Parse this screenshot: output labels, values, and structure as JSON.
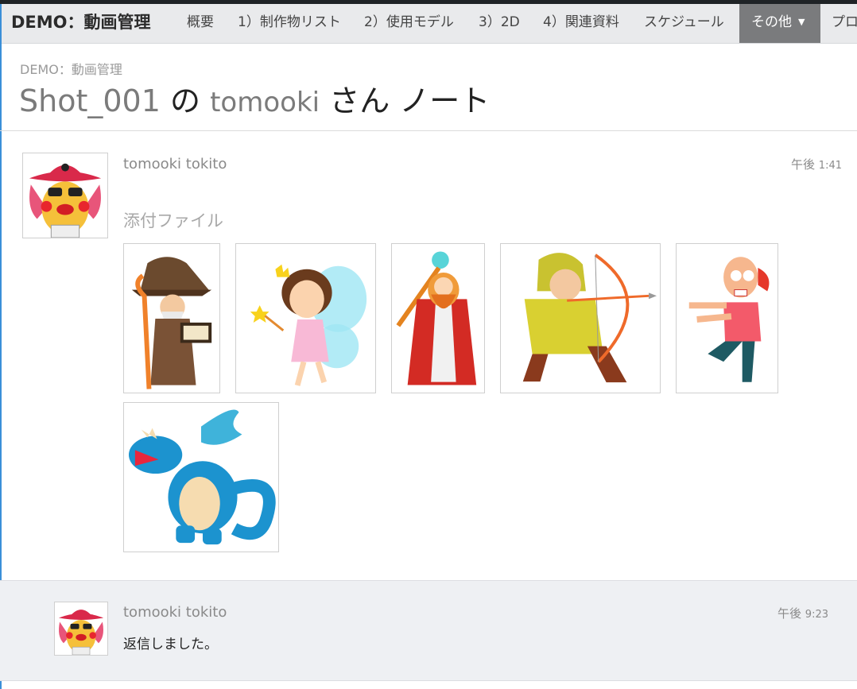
{
  "nav": {
    "brand": "DEMO：動画管理",
    "items": [
      "概要",
      "1）制作物リスト",
      "2）使用モデル",
      "3）2D",
      "4）関連資料",
      "スケジュール"
    ],
    "active": "その他",
    "overflow": "プロ"
  },
  "header": {
    "breadcrumb": "DEMO：動画管理",
    "title_shot": "Shot_001",
    "title_no": "の",
    "title_user": "tomooki",
    "title_rest": "さん ノート"
  },
  "note": {
    "author": "tomooki tokito",
    "time_prefix": "午後",
    "time": "1:41",
    "attachments_label": "添付ファイル",
    "attachments": [
      "wizard-image",
      "fairy-image",
      "sorcerer-image",
      "archer-image",
      "zombie-image",
      "dragon-image"
    ]
  },
  "reply": {
    "author": "tomooki tokito",
    "time_prefix": "午後",
    "time": "9:23",
    "text": "返信しました。"
  },
  "colors": {
    "nav_bg": "#e9eaec",
    "nav_active": "#7a7b7d",
    "reply_bg": "#eef0f3",
    "accent_line": "#3a8fd8"
  }
}
